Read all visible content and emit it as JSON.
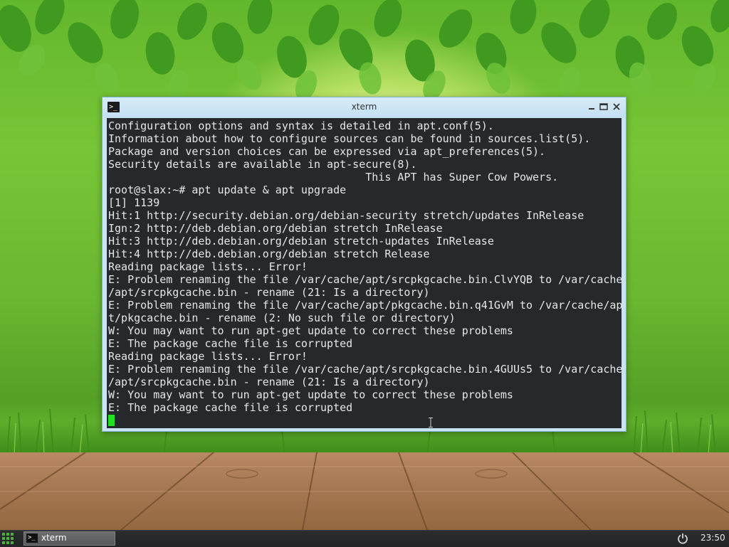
{
  "window": {
    "title": "xterm",
    "icon": "terminal-icon",
    "controls": [
      "minimize-icon",
      "maximize-icon",
      "close-icon"
    ]
  },
  "terminal": {
    "lines": [
      "Configuration options and syntax is detailed in apt.conf(5).",
      "Information about how to configure sources can be found in sources.list(5).",
      "Package and version choices can be expressed via apt_preferences(5).",
      "Security details are available in apt-secure(8).",
      "                                        This APT has Super Cow Powers.",
      "root@slax:~# apt update & apt upgrade",
      "[1] 1139",
      "Hit:1 http://security.debian.org/debian-security stretch/updates InRelease",
      "Ign:2 http://deb.debian.org/debian stretch InRelease",
      "Hit:3 http://deb.debian.org/debian stretch-updates InRelease",
      "Hit:4 http://deb.debian.org/debian stretch Release",
      "Reading package lists... Error!",
      "E: Problem renaming the file /var/cache/apt/srcpkgcache.bin.ClvYQB to /var/cache",
      "/apt/srcpkgcache.bin - rename (21: Is a directory)",
      "E: Problem renaming the file /var/cache/apt/pkgcache.bin.q41GvM to /var/cache/ap",
      "t/pkgcache.bin - rename (2: No such file or directory)",
      "W: You may want to run apt-get update to correct these problems",
      "E: The package cache file is corrupted",
      "Reading package lists... Error!",
      "E: Problem renaming the file /var/cache/apt/srcpkgcache.bin.4GUUs5 to /var/cache",
      "/apt/srcpkgcache.bin - rename (21: Is a directory)",
      "W: You may want to run apt-get update to correct these problems",
      "E: The package cache file is corrupted"
    ],
    "cursor_color": "#22e022",
    "background": "#26292b",
    "foreground": "#e6e6e6"
  },
  "taskbar": {
    "menu_icon": "app-grid-icon",
    "tasks": [
      {
        "label": "xterm",
        "icon": "terminal-icon"
      }
    ],
    "power_icon": "power-icon",
    "clock": "23:50"
  },
  "colors": {
    "window_frame": "#c9e3f5",
    "menu_green": "#4caf3a"
  }
}
